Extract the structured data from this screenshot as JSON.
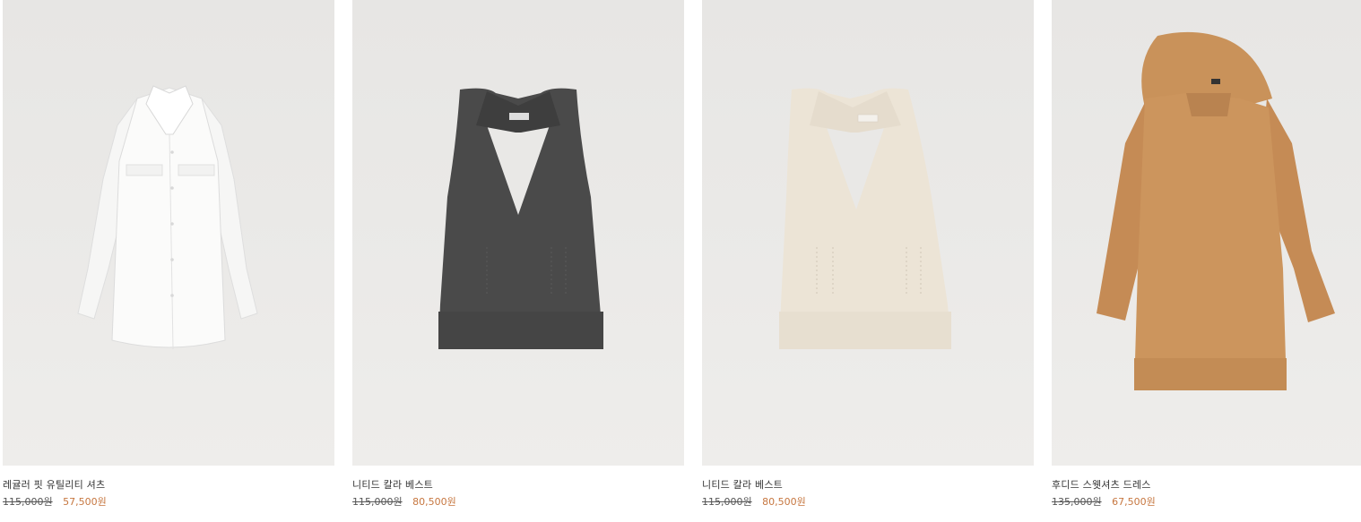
{
  "theme": {
    "sale_color": "#c6763f"
  },
  "products": [
    {
      "name": "레귤러 핏 유틸리티 셔츠",
      "original_price": "115,000원",
      "sale_price": "57,500원",
      "image_icon": "white-shirt-image"
    },
    {
      "name": "니티드 칼라 베스트",
      "original_price": "115,000원",
      "sale_price": "80,500원",
      "image_icon": "charcoal-knit-vest-image"
    },
    {
      "name": "니티드 칼라 베스트",
      "original_price": "115,000원",
      "sale_price": "80,500원",
      "image_icon": "cream-knit-vest-image"
    },
    {
      "name": "후디드 스웻셔츠 드레스",
      "original_price": "135,000원",
      "sale_price": "67,500원",
      "image_icon": "camel-hoodie-dress-image"
    }
  ]
}
